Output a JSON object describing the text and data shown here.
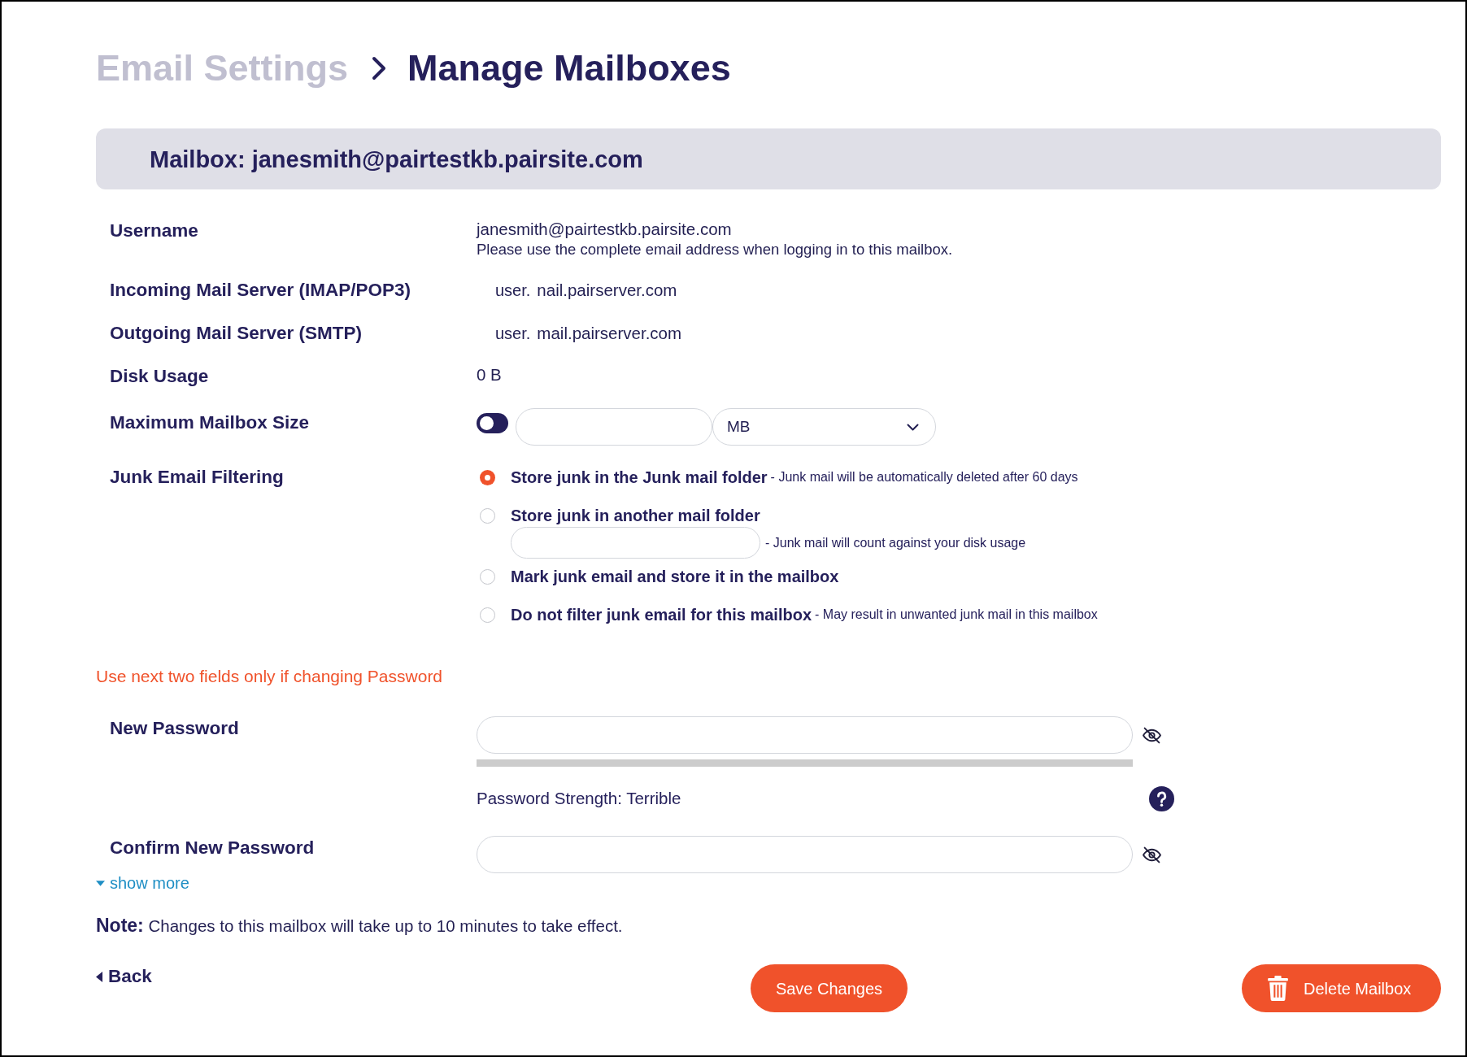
{
  "breadcrumb": [
    {
      "label": "Email Settings",
      "current": false
    },
    {
      "label": "Manage Mailboxes",
      "current": true
    }
  ],
  "mailbox_header": "Mailbox: janesmith@pairtestkb.pairsite.com",
  "fields": [
    {
      "kind": "text",
      "label": "Username",
      "value": "janesmith@pairtestkb.pairsite.com",
      "note": "Please use the complete email address when logging in to this mailbox."
    },
    {
      "kind": "server",
      "label": "Incoming Mail Server (IMAP/POP3)",
      "prefix": "user.",
      "host": "nail.pairserver.com"
    },
    {
      "kind": "server",
      "label": "Outgoing Mail Server (SMTP)",
      "prefix": "user.",
      "host": "mail.pairserver.com"
    },
    {
      "kind": "text",
      "label": "Disk Usage",
      "value": "0 B"
    },
    {
      "kind": "size",
      "label": "Maximum Mailbox Size",
      "toggle_on": false,
      "unit": "MB"
    },
    {
      "kind": "radio",
      "label": "Junk Email Filtering",
      "options": [
        {
          "kind": "plain",
          "label": "Store junk in the Junk mail folder",
          "hint": "- Junk mail will be automatically deleted after 60 days",
          "selected": true
        },
        {
          "kind": "folder",
          "label": "Store junk in another mail folder",
          "hint": "- Junk mail will count against your disk usage",
          "selected": false
        },
        {
          "kind": "plain",
          "label": "Mark junk email and store it in the mailbox",
          "selected": false
        },
        {
          "kind": "plain",
          "label": "Do not filter junk email for this mailbox",
          "hint": "- May result in unwanted junk mail in this mailbox",
          "selected": false
        }
      ]
    }
  ],
  "password": {
    "notice": "Use next two fields only if changing Password",
    "fields": [
      {
        "label": "New Password",
        "strength": {
          "level": 0,
          "text": "Password Strength: Terrible"
        }
      },
      {
        "label": "Confirm New Password"
      }
    ]
  },
  "show_more": "show more",
  "note": "**Note:** Changes to this mailbox will take up to 10 minutes to take effect.",
  "actions": [
    {
      "kind": "back",
      "label": "Back"
    },
    {
      "kind": "save",
      "label": "Save Changes"
    },
    {
      "kind": "delete",
      "label": "Delete Mailbox"
    }
  ]
}
